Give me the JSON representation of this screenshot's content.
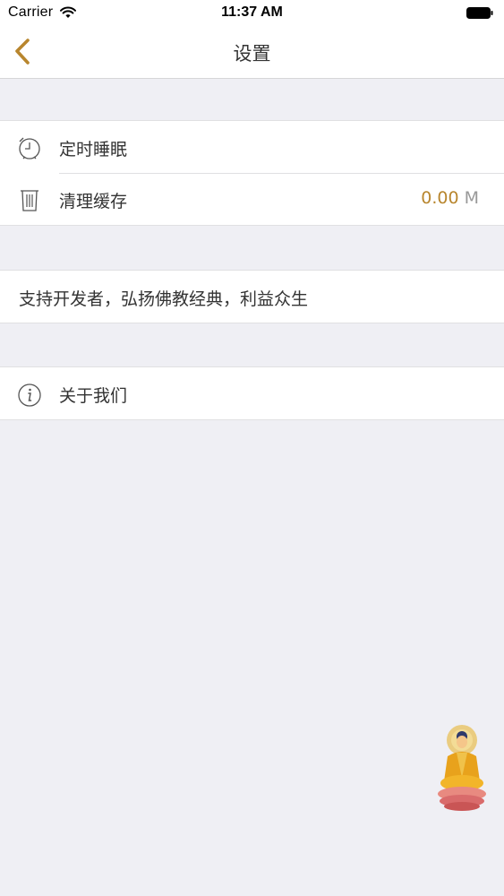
{
  "status_bar": {
    "carrier": "Carrier",
    "time": "11:37 AM"
  },
  "nav": {
    "title": "设置",
    "back_icon": "chevron-left-icon"
  },
  "settings": {
    "group1": {
      "sleep_timer": {
        "label": "定时睡眠",
        "icon": "alarm-clock-icon"
      },
      "clear_cache": {
        "label": "清理缓存",
        "icon": "trash-icon",
        "value": "0.00",
        "unit": "M"
      }
    },
    "group2": {
      "support": {
        "label": "支持开发者，弘扬佛教经典，利益众生"
      }
    },
    "group3": {
      "about": {
        "label": "关于我们",
        "icon": "info-icon"
      }
    }
  },
  "floating": {
    "icon": "buddha-figure-icon"
  },
  "colors": {
    "accent": "#b8862e",
    "background": "#efeff4",
    "cell": "#ffffff",
    "separator": "#e0e0e2"
  }
}
